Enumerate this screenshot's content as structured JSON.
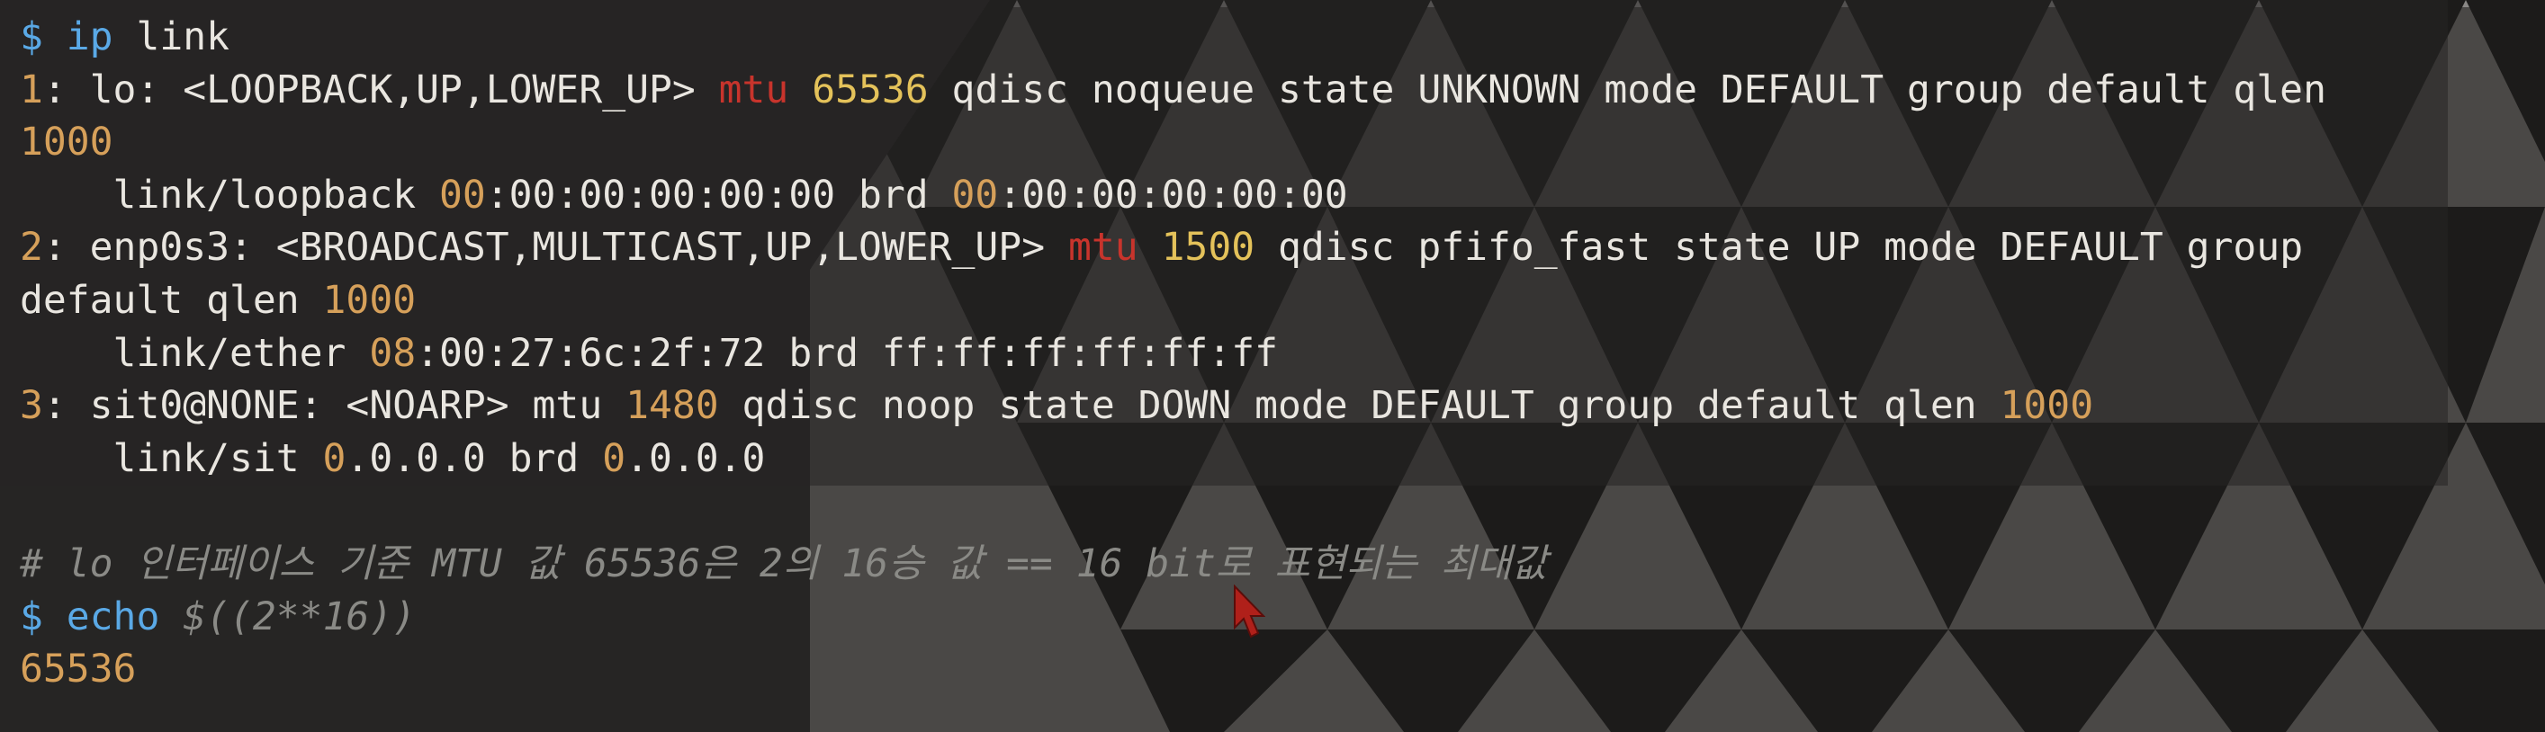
{
  "terminal": {
    "lines": [
      [
        {
          "t": "$ ",
          "c": "prompt"
        },
        {
          "t": "ip",
          "c": "cmd"
        },
        {
          "t": " link",
          "c": "plain"
        }
      ],
      [
        {
          "t": "1",
          "c": "num"
        },
        {
          "t": ": lo: <LOOPBACK,UP,LOWER_UP> ",
          "c": "plain"
        },
        {
          "t": "mtu",
          "c": "kw-red"
        },
        {
          "t": " ",
          "c": "plain"
        },
        {
          "t": "65536",
          "c": "num-bright"
        },
        {
          "t": " qdisc noqueue state UNKNOWN mode DEFAULT group default qlen",
          "c": "plain"
        }
      ],
      [
        {
          "t": "1000",
          "c": "num"
        }
      ],
      [
        {
          "t": "    link/loopback ",
          "c": "plain"
        },
        {
          "t": "00",
          "c": "num"
        },
        {
          "t": ":00:00:00:00:00 brd ",
          "c": "plain"
        },
        {
          "t": "00",
          "c": "num"
        },
        {
          "t": ":00:00:00:00:00",
          "c": "plain"
        }
      ],
      [
        {
          "t": "2",
          "c": "num"
        },
        {
          "t": ": enp0s3: <BROADCAST,MULTICAST,UP,LOWER_UP> ",
          "c": "plain"
        },
        {
          "t": "mtu",
          "c": "kw-red"
        },
        {
          "t": " ",
          "c": "plain"
        },
        {
          "t": "1500",
          "c": "num-bright"
        },
        {
          "t": " qdisc pfifo_fast state UP mode DEFAULT group",
          "c": "plain"
        }
      ],
      [
        {
          "t": "default qlen ",
          "c": "plain"
        },
        {
          "t": "1000",
          "c": "num"
        }
      ],
      [
        {
          "t": "    link/ether ",
          "c": "plain"
        },
        {
          "t": "08",
          "c": "num"
        },
        {
          "t": ":00:27:6c:2f:72 brd ff:ff:ff:ff:ff:ff",
          "c": "plain"
        }
      ],
      [
        {
          "t": "3",
          "c": "num"
        },
        {
          "t": ": sit0@NONE: <NOARP> mtu ",
          "c": "plain"
        },
        {
          "t": "1480",
          "c": "num"
        },
        {
          "t": " qdisc noop state DOWN mode DEFAULT group default qlen ",
          "c": "plain"
        },
        {
          "t": "1000",
          "c": "num"
        }
      ],
      [
        {
          "t": "    link/sit ",
          "c": "plain"
        },
        {
          "t": "0",
          "c": "num"
        },
        {
          "t": ".0.0.0 brd ",
          "c": "plain"
        },
        {
          "t": "0",
          "c": "num"
        },
        {
          "t": ".0.0.0",
          "c": "plain"
        }
      ],
      [],
      [
        {
          "t": "# lo 인터페이스 기준 MTU 값 65536은 2의 16승 값 == 16 bit로 표현되는 최대값",
          "c": "comment"
        }
      ],
      [
        {
          "t": "$ ",
          "c": "prompt"
        },
        {
          "t": "echo",
          "c": "cmd"
        },
        {
          "t": " ",
          "c": "plain"
        },
        {
          "t": "$((2**16))",
          "c": "comment"
        }
      ],
      [
        {
          "t": "65536",
          "c": "num"
        }
      ]
    ]
  },
  "colors": {
    "background": "#262524",
    "foreground": "#e9e6e0",
    "prompt": "#5aa9e6",
    "number": "#d6a05a",
    "mtu_keyword": "#c8342c",
    "comment": "#8a8a86"
  },
  "cursor": {
    "icon": "mouse-pointer-icon",
    "color": "#b0201a"
  }
}
